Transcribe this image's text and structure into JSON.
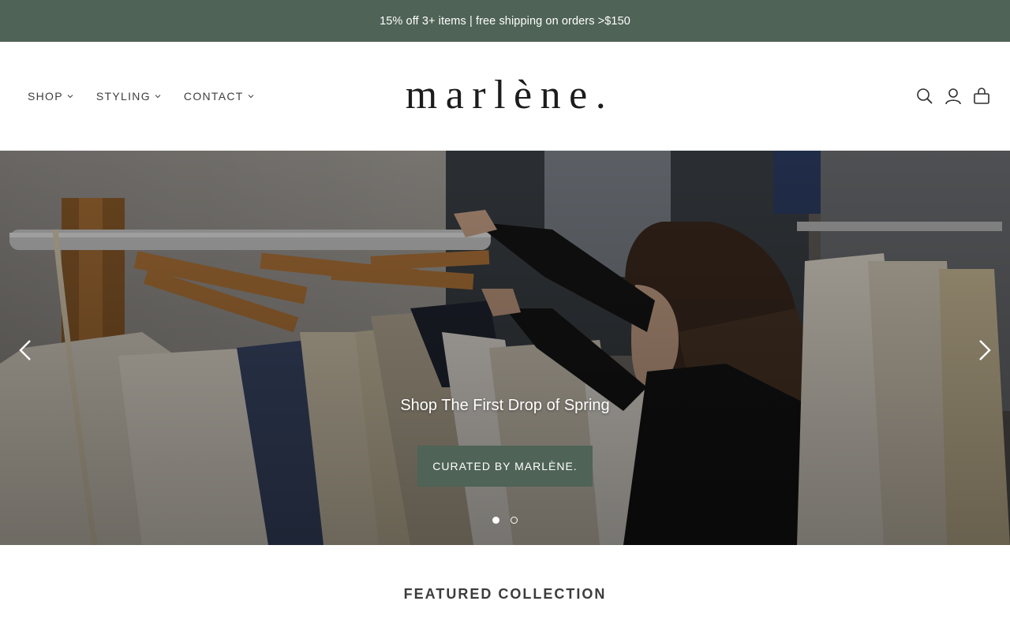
{
  "announcement": {
    "text": "15% off 3+ items | free shipping on orders >$150"
  },
  "header": {
    "logo": "marlène.",
    "nav": [
      {
        "label": "SHOP",
        "icon": "chevron-down-icon"
      },
      {
        "label": "STYLING",
        "icon": "chevron-down-icon"
      },
      {
        "label": "CONTACT",
        "icon": "chevron-down-icon"
      }
    ],
    "icons": [
      "search-icon",
      "account-icon",
      "bag-icon"
    ]
  },
  "hero": {
    "caption": "Shop The First Drop of Spring",
    "cta_label": "CURATED BY MARLÈNE.",
    "slide_count": 2,
    "active_slide": 1,
    "image_subject": "woman browsing clothing rack"
  },
  "featured": {
    "title": "FEATURED COLLECTION"
  },
  "colors": {
    "brand_green": "#4f6356",
    "text": "#3c3c3c",
    "white": "#ffffff"
  }
}
